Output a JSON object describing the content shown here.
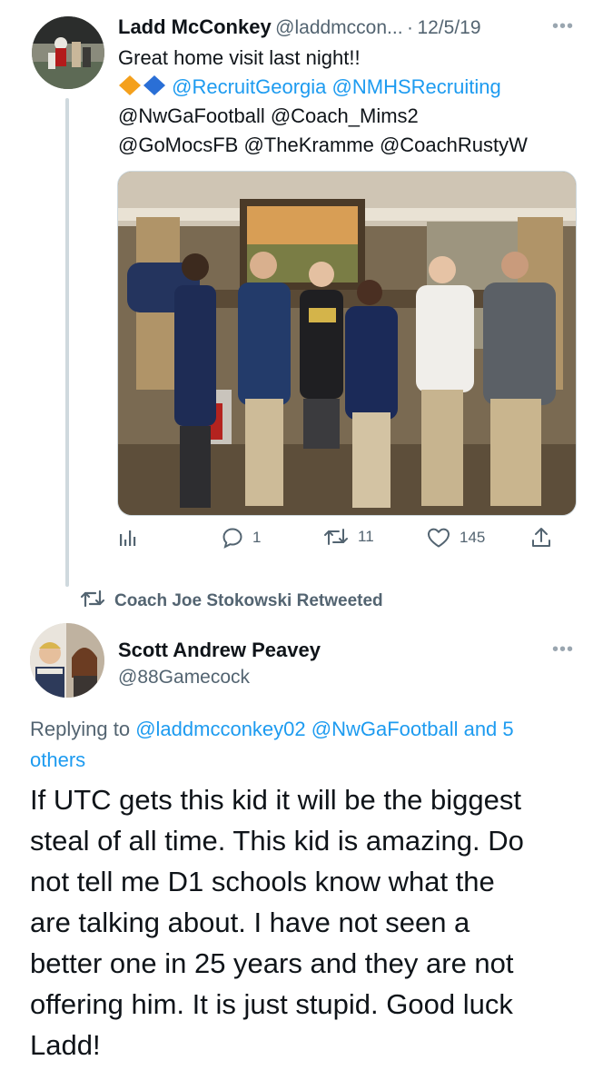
{
  "tweet1": {
    "name": "Ladd McConkey",
    "handle": "@laddmccon...",
    "sep": "·",
    "date": "12/5/19",
    "line1": "Great home visit last night!!",
    "mentions_line1": "@RecruitGeorgia @NMHSRecruiting",
    "mentions_line2": "@NwGaFootball @Coach_Mims2",
    "mentions_line3": "@GoMocsFB @TheKramme @CoachRustyW",
    "replies": "1",
    "retweets": "11",
    "likes": "145",
    "icons": [
      "orange-diamond-icon",
      "blue-diamond-icon",
      "analytics-icon",
      "reply-icon",
      "retweet-icon",
      "like-icon",
      "share-icon",
      "more-icon"
    ]
  },
  "retweet_banner": {
    "text": "Coach Joe Stokowski Retweeted"
  },
  "tweet2": {
    "name": "Scott Andrew Peavey",
    "handle": "@88Gamecock",
    "replying_prefix": "Replying to",
    "replying_mentions": "@laddmcconkey02 @NwGaFootball and 5",
    "replying_suffix": "others",
    "body_lines": [
      "If UTC gets this kid it will be the biggest",
      "steal of all time. This kid is amazing. Do",
      "not tell me D1 schools know what the",
      "are talking about. I have not seen a",
      "better one in 25 years and they are not",
      "offering him. It is just stupid. Good luck",
      "Ladd!"
    ]
  },
  "colors": {
    "link": "#1d9bf0",
    "muted": "#536471",
    "line": "#cfd9de",
    "text": "#0f1419"
  }
}
